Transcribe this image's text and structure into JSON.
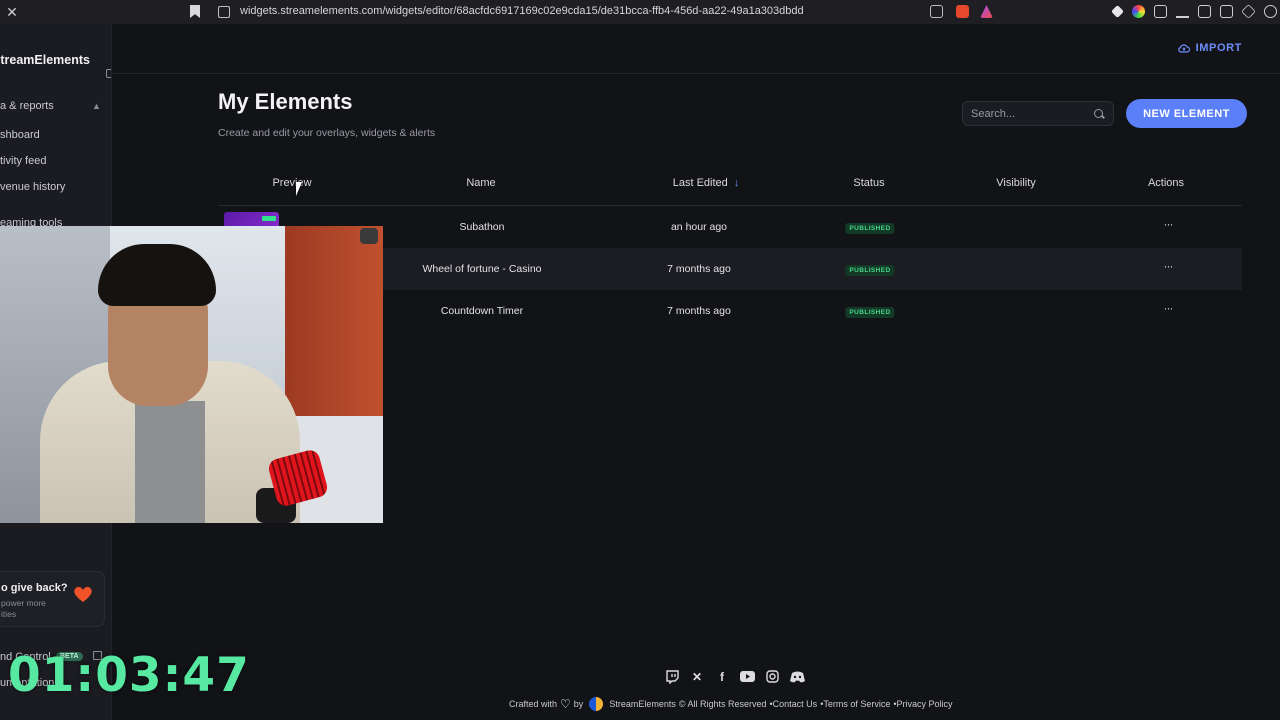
{
  "browser": {
    "url": "widgets.streamelements.com/widgets/editor/68acfdc6917169c02e9cda15/de31bcca-ffb4-456d-aa22-49a1a303dbdd",
    "close_glyph": "✕"
  },
  "sidebar": {
    "brand": "StreamElements",
    "groups": [
      {
        "label": "Data & reports",
        "visible_label": "a & reports"
      },
      {
        "label": "Streaming tools",
        "visible_label": "eaming tools"
      }
    ],
    "items": [
      {
        "visible_label": "shboard"
      },
      {
        "visible_label": "tivity feed"
      },
      {
        "visible_label": "venue history"
      }
    ],
    "give_back": {
      "title": "o give back?",
      "subtitle": "power more\nities"
    },
    "command_control": {
      "label": "nd Control",
      "badge": "BETA"
    },
    "docs_label": "umentation"
  },
  "overlay": {
    "timer": "01:03:47"
  },
  "header": {
    "import_label": "IMPORT"
  },
  "page": {
    "title": "My Elements",
    "subtitle": "Create and edit your overlays, widgets & alerts",
    "search_placeholder": "Search...",
    "new_button": "NEW ELEMENT"
  },
  "table": {
    "columns": [
      "Preview",
      "Name",
      "Last Edited",
      "Status",
      "Visibility",
      "Actions"
    ],
    "sort_indicator": "↓",
    "rows": [
      {
        "name": "Subathon",
        "last_edited": "an hour ago",
        "status": "PUBLISHED",
        "actions": "···"
      },
      {
        "name": "Wheel of fortune - Casino",
        "last_edited": "7 months ago",
        "status": "PUBLISHED",
        "actions": "···"
      },
      {
        "name": "Countdown Timer",
        "last_edited": "7 months ago",
        "status": "PUBLISHED",
        "actions": "···"
      }
    ]
  },
  "footer": {
    "crafted": "Crafted with",
    "by": "by",
    "brand": "StreamElements",
    "rights": "© All Rights Reserved",
    "contact": "•Contact Us",
    "terms": "•Terms of Service",
    "privacy": "•Privacy Policy",
    "socials": [
      "twitch-icon",
      "x-icon",
      "facebook-icon",
      "youtube-icon",
      "instagram-icon",
      "discord-icon"
    ]
  },
  "colors": {
    "accent": "#5b7ff7",
    "status_published": "#47d48a",
    "timer": "#57e8a2"
  }
}
